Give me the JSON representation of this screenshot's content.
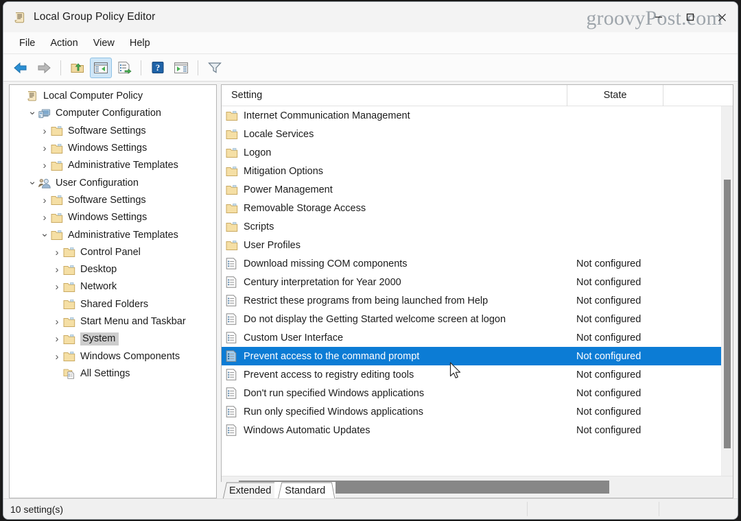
{
  "window": {
    "title": "Local Group Policy Editor",
    "icon": "policy-scroll-icon",
    "watermark": "groovyPost.com",
    "caption": {
      "minimize": "–",
      "maximize": "□",
      "close": "✕"
    }
  },
  "menubar": {
    "items": [
      {
        "label": "File"
      },
      {
        "label": "Action"
      },
      {
        "label": "View"
      },
      {
        "label": "Help"
      }
    ]
  },
  "toolbar": {
    "buttons": [
      {
        "name": "back-icon",
        "tip": "Back"
      },
      {
        "name": "forward-icon",
        "tip": "Forward"
      },
      {
        "name": "up-folder-icon",
        "tip": "Up One Level"
      },
      {
        "name": "show-hide-console-tree-icon",
        "tip": "Show/Hide Console Tree",
        "active": true
      },
      {
        "name": "export-list-icon",
        "tip": "Export List"
      },
      {
        "name": "help-icon",
        "tip": "Help"
      },
      {
        "name": "show-action-pane-icon",
        "tip": "Show/Hide Action Pane"
      },
      {
        "name": "filter-icon",
        "tip": "Filter"
      }
    ]
  },
  "tree": {
    "root": {
      "label": "Local Computer Policy",
      "icon": "policy-scroll-icon",
      "indent": 0,
      "twisty": "none"
    },
    "items": [
      {
        "label": "Local Computer Policy",
        "icon": "policy-scroll-icon",
        "indent": 0,
        "twisty": "none",
        "selected": false
      },
      {
        "label": "Computer Configuration",
        "icon": "computer-icon",
        "indent": 1,
        "twisty": "expanded",
        "selected": false
      },
      {
        "label": "Software Settings",
        "icon": "folder-icon",
        "indent": 2,
        "twisty": "collapsed",
        "selected": false
      },
      {
        "label": "Windows Settings",
        "icon": "folder-icon",
        "indent": 2,
        "twisty": "collapsed",
        "selected": false
      },
      {
        "label": "Administrative Templates",
        "icon": "folder-icon",
        "indent": 2,
        "twisty": "collapsed",
        "selected": false
      },
      {
        "label": "User Configuration",
        "icon": "user-icon",
        "indent": 1,
        "twisty": "expanded",
        "selected": false
      },
      {
        "label": "Software Settings",
        "icon": "folder-icon",
        "indent": 2,
        "twisty": "collapsed",
        "selected": false
      },
      {
        "label": "Windows Settings",
        "icon": "folder-icon",
        "indent": 2,
        "twisty": "collapsed",
        "selected": false
      },
      {
        "label": "Administrative Templates",
        "icon": "folder-icon",
        "indent": 2,
        "twisty": "expanded",
        "selected": false
      },
      {
        "label": "Control Panel",
        "icon": "folder-icon",
        "indent": 3,
        "twisty": "collapsed",
        "selected": false
      },
      {
        "label": "Desktop",
        "icon": "folder-icon",
        "indent": 3,
        "twisty": "collapsed",
        "selected": false
      },
      {
        "label": "Network",
        "icon": "folder-icon",
        "indent": 3,
        "twisty": "collapsed",
        "selected": false
      },
      {
        "label": "Shared Folders",
        "icon": "folder-icon",
        "indent": 3,
        "twisty": "none",
        "selected": false
      },
      {
        "label": "Start Menu and Taskbar",
        "icon": "folder-icon",
        "indent": 3,
        "twisty": "collapsed",
        "selected": false
      },
      {
        "label": "System",
        "icon": "folder-icon",
        "indent": 3,
        "twisty": "collapsed",
        "selected": true
      },
      {
        "label": "Windows Components",
        "icon": "folder-icon",
        "indent": 3,
        "twisty": "collapsed",
        "selected": false
      },
      {
        "label": "All Settings",
        "icon": "all-settings-icon",
        "indent": 3,
        "twisty": "none",
        "selected": false
      }
    ]
  },
  "list": {
    "columns": [
      {
        "label": "Setting",
        "align": "left"
      },
      {
        "label": "State",
        "align": "center"
      }
    ],
    "rows": [
      {
        "name": "Internet Communication Management",
        "state": "",
        "icon": "folder-icon",
        "selected": false
      },
      {
        "name": "Locale Services",
        "state": "",
        "icon": "folder-icon",
        "selected": false
      },
      {
        "name": "Logon",
        "state": "",
        "icon": "folder-icon",
        "selected": false
      },
      {
        "name": "Mitigation Options",
        "state": "",
        "icon": "folder-icon",
        "selected": false
      },
      {
        "name": "Power Management",
        "state": "",
        "icon": "folder-icon",
        "selected": false
      },
      {
        "name": "Removable Storage Access",
        "state": "",
        "icon": "folder-icon",
        "selected": false
      },
      {
        "name": "Scripts",
        "state": "",
        "icon": "folder-icon",
        "selected": false
      },
      {
        "name": "User Profiles",
        "state": "",
        "icon": "folder-icon",
        "selected": false
      },
      {
        "name": "Download missing COM components",
        "state": "Not configured",
        "icon": "policy-setting-icon",
        "selected": false
      },
      {
        "name": "Century interpretation for Year 2000",
        "state": "Not configured",
        "icon": "policy-setting-icon",
        "selected": false
      },
      {
        "name": "Restrict these programs from being launched from Help",
        "state": "Not configured",
        "icon": "policy-setting-icon",
        "selected": false
      },
      {
        "name": "Do not display the Getting Started welcome screen at logon",
        "state": "Not configured",
        "icon": "policy-setting-icon",
        "selected": false
      },
      {
        "name": "Custom User Interface",
        "state": "Not configured",
        "icon": "policy-setting-icon",
        "selected": false
      },
      {
        "name": "Prevent access to the command prompt",
        "state": "Not configured",
        "icon": "policy-setting-icon",
        "selected": true
      },
      {
        "name": "Prevent access to registry editing tools",
        "state": "Not configured",
        "icon": "policy-setting-icon",
        "selected": false
      },
      {
        "name": "Don't run specified Windows applications",
        "state": "Not configured",
        "icon": "policy-setting-icon",
        "selected": false
      },
      {
        "name": "Run only specified Windows applications",
        "state": "Not configured",
        "icon": "policy-setting-icon",
        "selected": false
      },
      {
        "name": "Windows Automatic Updates",
        "state": "Not configured",
        "icon": "policy-setting-icon",
        "selected": false
      }
    ]
  },
  "tabs": [
    {
      "label": "Extended",
      "active": false
    },
    {
      "label": "Standard",
      "active": true
    }
  ],
  "statusbar": {
    "text": "10 setting(s)"
  },
  "colors": {
    "selection_blue": "#0c7cd5",
    "tree_selection_gray": "#cdcdcd",
    "toolbar_active": "#cfe6f7",
    "scrollbar_thumb": "#878787",
    "window_bg": "#f3f3f3"
  }
}
